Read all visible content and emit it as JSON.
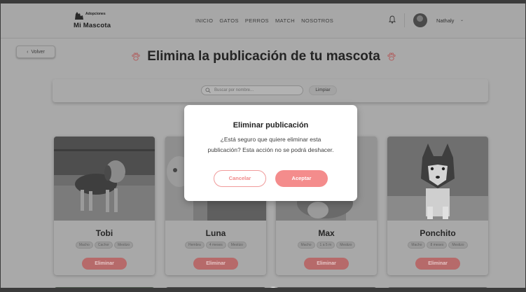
{
  "navbar": {
    "logo_small": "Adopciones",
    "logo_big": "Mi Mascota",
    "links": [
      "INICIO",
      "GATOS",
      "PERROS",
      "MATCH",
      "NOSOTROS"
    ],
    "user_name": "Nathaly",
    "user_chevron": "⌄"
  },
  "back": {
    "arrow": "‹",
    "label": "Volver"
  },
  "page": {
    "title": "Elimina la publicación de tu mascota"
  },
  "search": {
    "placeholder": "Buscar por nombre...",
    "clear_label": "Limpiar"
  },
  "pets": [
    {
      "name": "Tobi",
      "tags": [
        "Macho",
        "Cachor",
        "Mestizo"
      ],
      "delete_label": "Eliminar"
    },
    {
      "name": "Luna",
      "tags": [
        "Hembra",
        "4 meses",
        "Mestizo"
      ],
      "delete_label": "Eliminar"
    },
    {
      "name": "Max",
      "tags": [
        "Macho",
        "1 a 5 m",
        "Mestizo"
      ],
      "delete_label": "Eliminar"
    },
    {
      "name": "Ponchito",
      "tags": [
        "Macho",
        "8 meses",
        "Mestizo"
      ],
      "delete_label": "Eliminar"
    }
  ],
  "modal": {
    "title": "Eliminar publicación",
    "message": "¿Está seguro que quiere eliminar esta publicación? Esta acción no se podrá deshacer.",
    "cancel_label": "Cancelar",
    "accept_label": "Aceptar"
  },
  "colors": {
    "accent": "#f48c8c",
    "accent_dim": "#b66a6a",
    "overlay": "#a9a9a9",
    "modal_bg": "#ffffff"
  },
  "icons": {
    "logo": "dog-cat-logo-icon",
    "notifications": "bell-icon",
    "title_decoration": "paw-icon",
    "search": "search-icon",
    "scroll": "chevron-down-icon"
  }
}
